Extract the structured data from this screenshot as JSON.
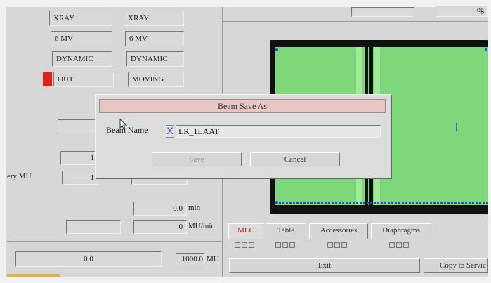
{
  "left_panel": {
    "beam_type_col1": "XRAY",
    "beam_type_col2": "XRAY",
    "energy_col1": "6 MV",
    "energy_col2": "6 MV",
    "technique_col1": "DYNAMIC",
    "technique_col2": "DYNAMIC",
    "status_col1": "OUT",
    "status_col2": "MOVING",
    "status_indicator_color": "#e0201c",
    "mu_value_1": "1",
    "mu_value_2": "1",
    "delivery_mu_label": "ery MU",
    "time_value": "0.0",
    "time_unit": "min",
    "mu_per_min_value": "0",
    "mu_per_min_unit": "MU/min",
    "bottom_left_value": "0.0",
    "bottom_mu_value": "1000.0",
    "bottom_mu_unit": "MU"
  },
  "top_right_fields": {
    "label_partial": "og"
  },
  "tabs": [
    {
      "label": "MLC",
      "active": true
    },
    {
      "label": "Table",
      "active": false
    },
    {
      "label": "Accessories",
      "active": false
    },
    {
      "label": "Diaphragms",
      "active": false
    }
  ],
  "buttons": {
    "exit": "Exit",
    "copy_to_service": "Copy to Servic"
  },
  "dialog": {
    "title": "Beam Save As",
    "name_label": "Beam Name",
    "clear_glyph": "X",
    "name_value": "LR_1LAAT",
    "save_label": "Save",
    "cancel_label": "Cancel"
  },
  "colors": {
    "field_green": "#7ed87b",
    "dialog_title_bg": "#e9c6c6",
    "active_tab_text": "#c81818"
  }
}
